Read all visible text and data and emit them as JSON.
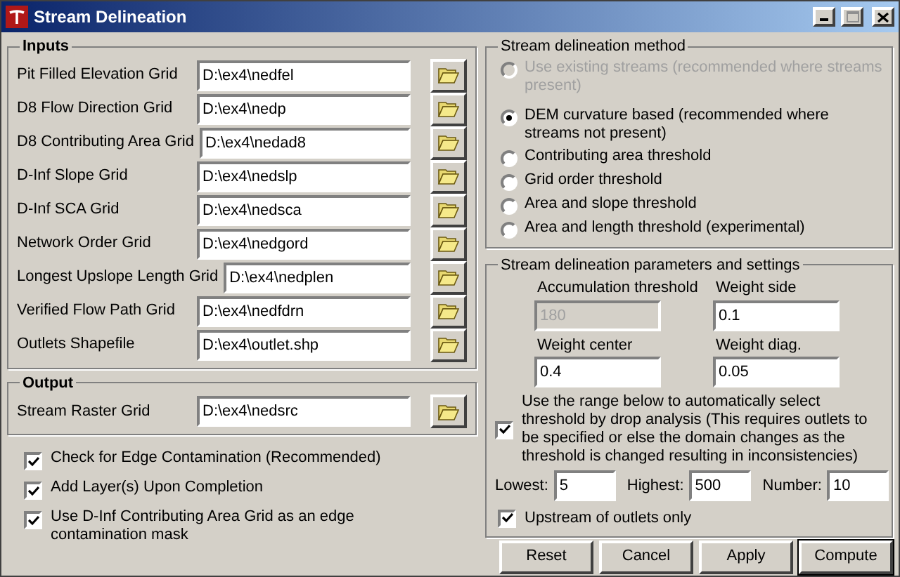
{
  "window": {
    "title": "Stream Delineation"
  },
  "inputs": {
    "title": "Inputs",
    "rows": [
      {
        "label": "Pit Filled Elevation Grid",
        "value": "D:\\ex4\\nedfel"
      },
      {
        "label": "D8 Flow Direction Grid",
        "value": "D:\\ex4\\nedp"
      },
      {
        "label": "D8 Contributing Area Grid",
        "value": "D:\\ex4\\nedad8"
      },
      {
        "label": "D-Inf Slope Grid",
        "value": "D:\\ex4\\nedslp"
      },
      {
        "label": "D-Inf SCA  Grid",
        "value": "D:\\ex4\\nedsca"
      },
      {
        "label": "Network Order Grid",
        "value": "D:\\ex4\\nedgord"
      },
      {
        "label": "Longest Upslope Length Grid",
        "value": "D:\\ex4\\nedplen"
      },
      {
        "label": "Verified Flow Path Grid",
        "value": "D:\\ex4\\nedfdrn"
      },
      {
        "label": "Outlets Shapefile",
        "value": "D:\\ex4\\outlet.shp"
      }
    ]
  },
  "output": {
    "title": "Output",
    "rows": [
      {
        "label": "Stream Raster Grid",
        "value": "D:\\ex4\\nedsrc"
      }
    ]
  },
  "options": [
    {
      "label": "Check for Edge Contamination (Recommended)",
      "checked": true
    },
    {
      "label": "Add Layer(s) Upon Completion",
      "checked": true
    },
    {
      "label": "Use D-Inf Contributing Area Grid as an edge contamination mask",
      "checked": true
    }
  ],
  "method": {
    "title": "Stream delineation method",
    "options": [
      {
        "label": "Use existing streams (recommended where streams present)",
        "selected": false,
        "disabled": true
      },
      {
        "label": "DEM curvature based (recommended where streams not present)",
        "selected": true,
        "disabled": false
      },
      {
        "label": "Contributing area threshold",
        "selected": false,
        "disabled": false
      },
      {
        "label": "Grid order threshold",
        "selected": false,
        "disabled": false
      },
      {
        "label": "Area and slope threshold",
        "selected": false,
        "disabled": false
      },
      {
        "label": "Area and length threshold (experimental)",
        "selected": false,
        "disabled": false
      }
    ]
  },
  "parameters": {
    "title": "Stream delineation parameters and settings",
    "fields": [
      {
        "label": "Accumulation threshold",
        "value": "180",
        "disabled": true
      },
      {
        "label": "Weight side",
        "value": "0.1",
        "disabled": false
      },
      {
        "label": "Weight center",
        "value": "0.4",
        "disabled": false
      },
      {
        "label": "Weight diag.",
        "value": "0.05",
        "disabled": false
      }
    ],
    "drop_analysis": {
      "label": "Use the range below to automatically select threshold by drop analysis (This requires outlets to be specified or else the domain changes as the threshold is changed resulting in inconsistencies)",
      "checked": true
    },
    "range": [
      {
        "label": "Lowest:",
        "value": "5"
      },
      {
        "label": "Highest:",
        "value": "500"
      },
      {
        "label": "Number:",
        "value": "10"
      }
    ],
    "upstream": {
      "label": "Upstream of outlets only",
      "checked": true
    }
  },
  "buttons": [
    {
      "label": "Reset",
      "default": false
    },
    {
      "label": "Cancel",
      "default": false
    },
    {
      "label": "Apply",
      "default": false
    },
    {
      "label": "Compute",
      "default": true
    }
  ]
}
